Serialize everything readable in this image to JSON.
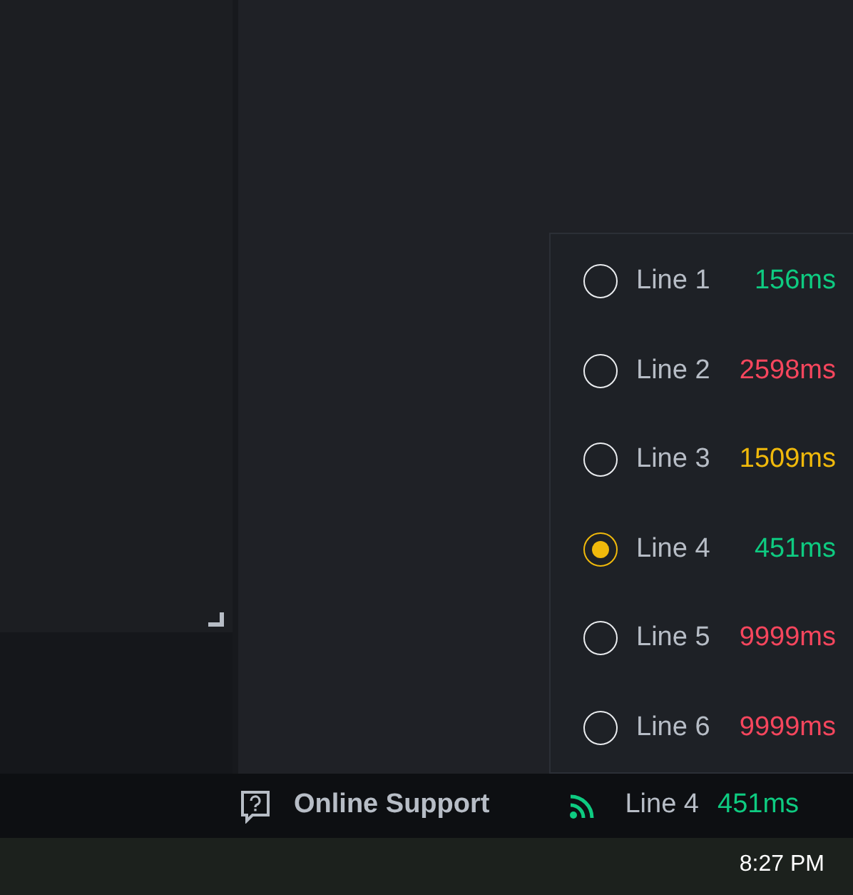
{
  "lines": [
    {
      "label": "Line 1",
      "latency": "156ms",
      "color": "#0ecb81",
      "selected": false
    },
    {
      "label": "Line 2",
      "latency": "2598ms",
      "color": "#f6465d",
      "selected": false
    },
    {
      "label": "Line 3",
      "latency": "1509ms",
      "color": "#f0b90b",
      "selected": false
    },
    {
      "label": "Line 4",
      "latency": "451ms",
      "color": "#0ecb81",
      "selected": true
    },
    {
      "label": "Line 5",
      "latency": "9999ms",
      "color": "#f6465d",
      "selected": false
    },
    {
      "label": "Line 6",
      "latency": "9999ms",
      "color": "#f6465d",
      "selected": false
    }
  ],
  "status_bar": {
    "support": "Online Support",
    "line": "Line 4",
    "latency": "451ms",
    "color": "#0ecb81"
  },
  "taskbar": {
    "time": "8:27 PM"
  }
}
